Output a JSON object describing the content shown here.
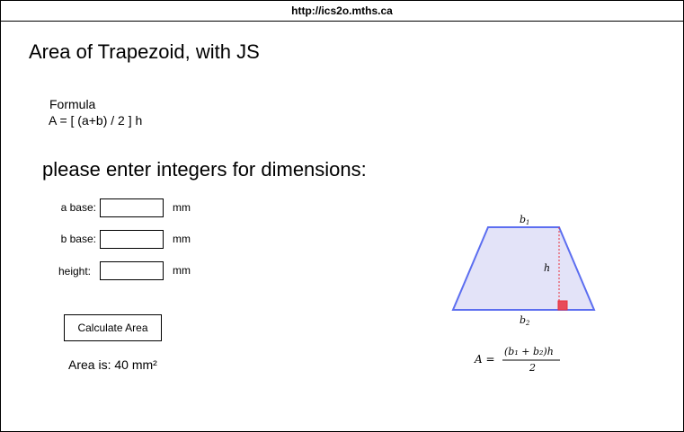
{
  "url": "http://ics2o.mths.ca",
  "title": "Area of Trapezoid, with JS",
  "formula": {
    "label": "Formula",
    "text": "A = [ (a+b) / 2 ] h"
  },
  "prompt": "please enter integers for dimensions:",
  "fields": [
    {
      "label": "a base:",
      "value": "",
      "unit": "mm"
    },
    {
      "label": "b base:",
      "value": "",
      "unit": "mm"
    },
    {
      "label": "height:",
      "value": "",
      "unit": "mm"
    }
  ],
  "calculate_button": "Calculate Area",
  "result": "Area is: 40 mm²",
  "diagram": {
    "top_label": "b",
    "top_sub": "1",
    "bottom_label": "b",
    "bottom_sub": "2",
    "height_label": "h",
    "fill_color": "#e3e3f8",
    "edge_color": "#5c6ef0",
    "height_line_color": "#e8303c",
    "right_angle_color": "#e84a5a"
  },
  "area_formula": {
    "lhs": "A =",
    "numerator": "(b₁ + b₂)h",
    "denominator": "2"
  }
}
